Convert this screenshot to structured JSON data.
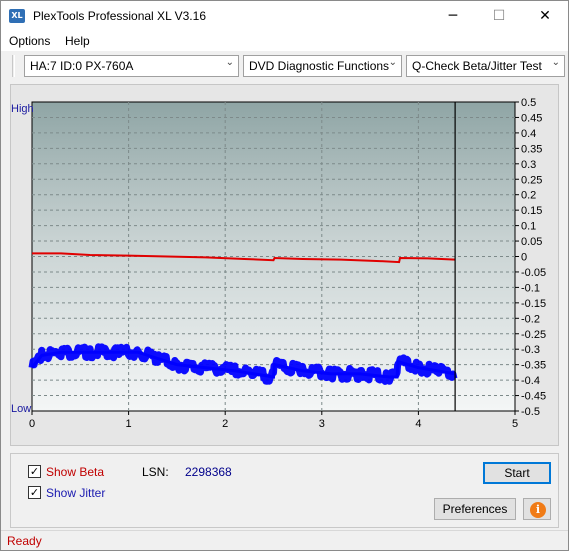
{
  "window": {
    "icon_text": "XL",
    "title": "PlexTools Professional XL V3.16",
    "minimize": "─",
    "maximize": "☐",
    "close": "✕"
  },
  "menu": {
    "options": "Options",
    "help": "Help"
  },
  "toolbar": {
    "drive": "HA:7 ID:0  PX-760A",
    "function": "DVD Diagnostic Functions",
    "test": "Q-Check Beta/Jitter Test"
  },
  "chart_data": {
    "type": "line",
    "left_axis_labels": {
      "top": "High",
      "bottom": "Low"
    },
    "x_ticks": [
      "0",
      "1",
      "2",
      "3",
      "4",
      "5"
    ],
    "xlim": [
      0,
      5
    ],
    "ylim": [
      -0.5,
      0.5
    ],
    "y_ticks": [
      "0.5",
      "0.45",
      "0.4",
      "0.35",
      "0.3",
      "0.25",
      "0.2",
      "0.15",
      "0.1",
      "0.05",
      "0",
      "-0.05",
      "-0.1",
      "-0.15",
      "-0.2",
      "-0.25",
      "-0.3",
      "-0.35",
      "-0.4",
      "-0.45",
      "-0.5"
    ],
    "end_marker_x": 4.38,
    "grid": true,
    "series": [
      {
        "color": "#e00000",
        "x": [
          0,
          0.3,
          0.6,
          1.0,
          1.4,
          1.8,
          2.2,
          2.5,
          2.51,
          2.8,
          3.2,
          3.6,
          3.8,
          3.81,
          4.1,
          4.38
        ],
        "values": [
          0.01,
          0.01,
          0.005,
          0.003,
          0.0,
          -0.003,
          -0.008,
          -0.012,
          -0.005,
          -0.008,
          -0.01,
          -0.015,
          -0.018,
          -0.005,
          -0.006,
          -0.01
        ]
      },
      {
        "color": "#0000ff",
        "x": [
          0,
          0.1,
          0.3,
          0.6,
          0.9,
          1.1,
          1.3,
          1.5,
          1.8,
          2.1,
          2.3,
          2.5,
          2.51,
          2.8,
          3.1,
          3.4,
          3.7,
          3.78,
          3.79,
          4.0,
          4.2,
          4.38
        ],
        "values": [
          -0.36,
          -0.32,
          -0.31,
          -0.31,
          -0.31,
          -0.31,
          -0.33,
          -0.35,
          -0.36,
          -0.37,
          -0.38,
          -0.39,
          -0.35,
          -0.37,
          -0.38,
          -0.38,
          -0.39,
          -0.39,
          -0.34,
          -0.36,
          -0.37,
          -0.38
        ]
      }
    ]
  },
  "controls": {
    "show_beta": "Show Beta",
    "show_jitter": "Show Jitter",
    "beta_checked": "✓",
    "jitter_checked": "✓",
    "lsn_label": "LSN:",
    "lsn_value": "2298368",
    "start": "Start",
    "preferences": "Preferences",
    "info": "i"
  },
  "status": {
    "text": "Ready"
  },
  "colors": {
    "beta": "#e00000",
    "jitter": "#0000ff",
    "status": "#c00000"
  }
}
